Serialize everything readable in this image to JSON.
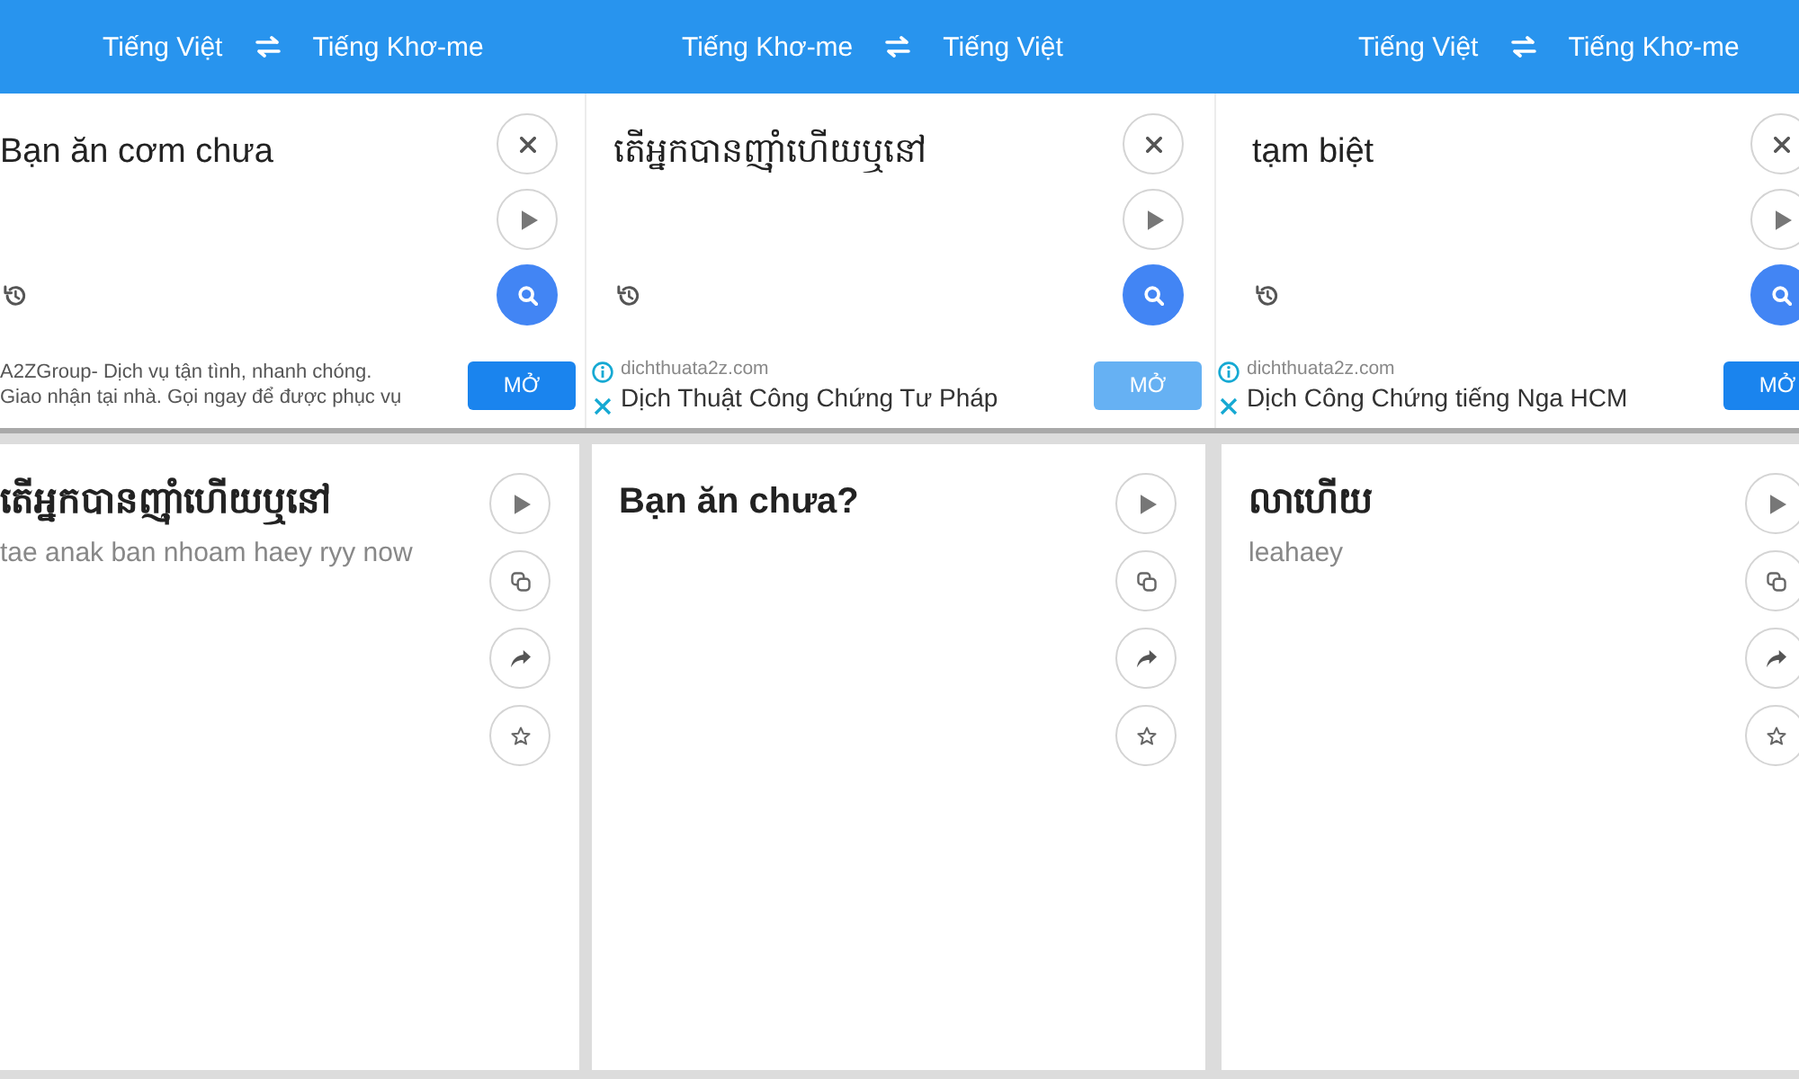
{
  "panels": [
    {
      "header": {
        "source_language": "Tiếng Việt",
        "target_language": "Tiếng Khơ-me"
      },
      "input": {
        "text": "Bạn ăn cơm chưa"
      },
      "ad": {
        "kind": "description",
        "marks": false,
        "lines": [
          "A2ZGroup- Dịch vụ tận tình, nhanh chóng.",
          "Giao nhận tại nhà. Gọi ngay để được phục vụ"
        ],
        "button": "MỞ",
        "button_faded": false
      },
      "result": {
        "translation": "តើអ្នកបានញ៉ាំហើយឬនៅ",
        "romanization": "tae anak ban nhoam haey ryy now"
      }
    },
    {
      "header": {
        "source_language": "Tiếng Khơ-me",
        "target_language": "Tiếng Việt"
      },
      "input": {
        "text": "តើអ្នកបានញ៉ាំហើយឬនៅ"
      },
      "ad": {
        "kind": "headline",
        "marks": true,
        "domain": "dichthuata2z.com",
        "headline": "Dịch Thuật Công Chứng Tư Pháp",
        "button": "MỞ",
        "button_faded": true
      },
      "result": {
        "translation": "Bạn ăn chưa?"
      }
    },
    {
      "header": {
        "source_language": "Tiếng Việt",
        "target_language": "Tiếng Khơ-me"
      },
      "input": {
        "text": "tạm biệt"
      },
      "ad": {
        "kind": "headline",
        "marks": true,
        "domain": "dichthuata2z.com",
        "headline": "Dịch Công Chứng tiếng Nga HCM",
        "button": "MỞ",
        "button_faded": false
      },
      "result": {
        "translation": "លាហើយ",
        "romanization": "leahaey"
      }
    }
  ]
}
